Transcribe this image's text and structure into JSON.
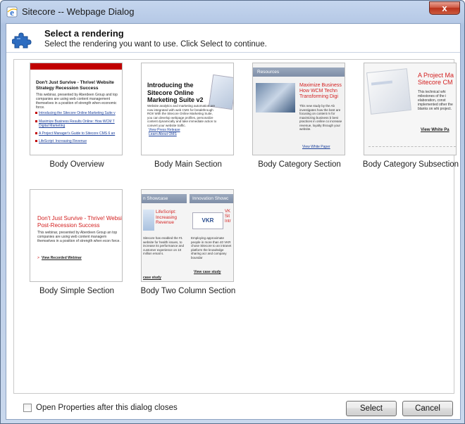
{
  "window": {
    "title": "Sitecore -- Webpage Dialog",
    "close_glyph": "x"
  },
  "header": {
    "title": "Select a rendering",
    "subtitle": "Select the rendering you want to use. Click Select to continue."
  },
  "renderings": [
    {
      "label": "Body Overview",
      "thumb": {
        "title": "Don't Just Survive - Thrive! Website Strategy Recession Success",
        "body": "This webinar, presented by Aberdeen Group and top companies are using web content management themselves in a position of strength when economic force.",
        "links": [
          "Introducing the Sitecore Online Marketing Suite v",
          "Maximize Business Results Online: How WCM T",
          "Digital Marketing",
          "A Project Manager's Guide to Sitecore CMS 6 an",
          "LifeScript: Increasing Revenue"
        ]
      }
    },
    {
      "label": "Body Main Section",
      "thumb": {
        "title": "Introducing the Sitecore Online Marketing Suite v2",
        "body": "Website analytics and marketing automation are now integrated with web CMS for breakthrough ROI! With the Sitecore Online Marketing Suite, you can develop webpage profiles, personalize content dynamically and take immediate action to convert your website traffic.",
        "links": [
          "View Press Release",
          "Learn About OMS"
        ]
      }
    },
    {
      "label": "Body Category Section",
      "thumb": {
        "bar": "Resources",
        "title": "Maximize Business How WCM Techn Transforming Digi",
        "body": "This new study by the Ab investigates how the best are focusing on content m for maximizing business b best practices in online co increase revenue, loyalty through your website.",
        "link": "View White Paper"
      }
    },
    {
      "label": "Body Category Subsection",
      "thumb": {
        "title": "A Project Ma Sitecore CM",
        "body": "This technical whi milestones of the i elaboration, const implemented other the blanks on whi project.",
        "link": "View White Pa"
      }
    },
    {
      "label": "Body Simple Section",
      "thumb": {
        "title": "Don't Just Survive - Thrive! Websi Post-Recession Success",
        "body": "This webinar, presented by Aberdeen Group an top companies are using web content managem themselves in a position of strength when econ force.",
        "link": "View Recorded Webinar"
      }
    },
    {
      "label": "Body Two Column Section",
      "thumb": {
        "left_bar": "n Showcase",
        "right_bar": "Innovation Showc",
        "left_title": "LifeScript: Increasing Revenue",
        "right_title": "VK Sit Intr",
        "logo": "VKR",
        "left_body": "Sitecore has enabled the #1 website for health issues, to increase its performance and customer experience on 10 million email s.",
        "right_body": "Employing approximate people in more than 40 VKR chose Sitecore to an intranet platform the knowledge sharing acr and company boundar",
        "left_link": "case study",
        "right_link": "View case study"
      }
    }
  ],
  "footer": {
    "checkbox_label": "Open Properties after this dialog closes",
    "checkbox_checked": false,
    "select_label": "Select",
    "cancel_label": "Cancel"
  },
  "colors": {
    "accent_red": "#d32020",
    "title_bar": "#b6c9e6",
    "link_blue": "#1a3f9a"
  }
}
